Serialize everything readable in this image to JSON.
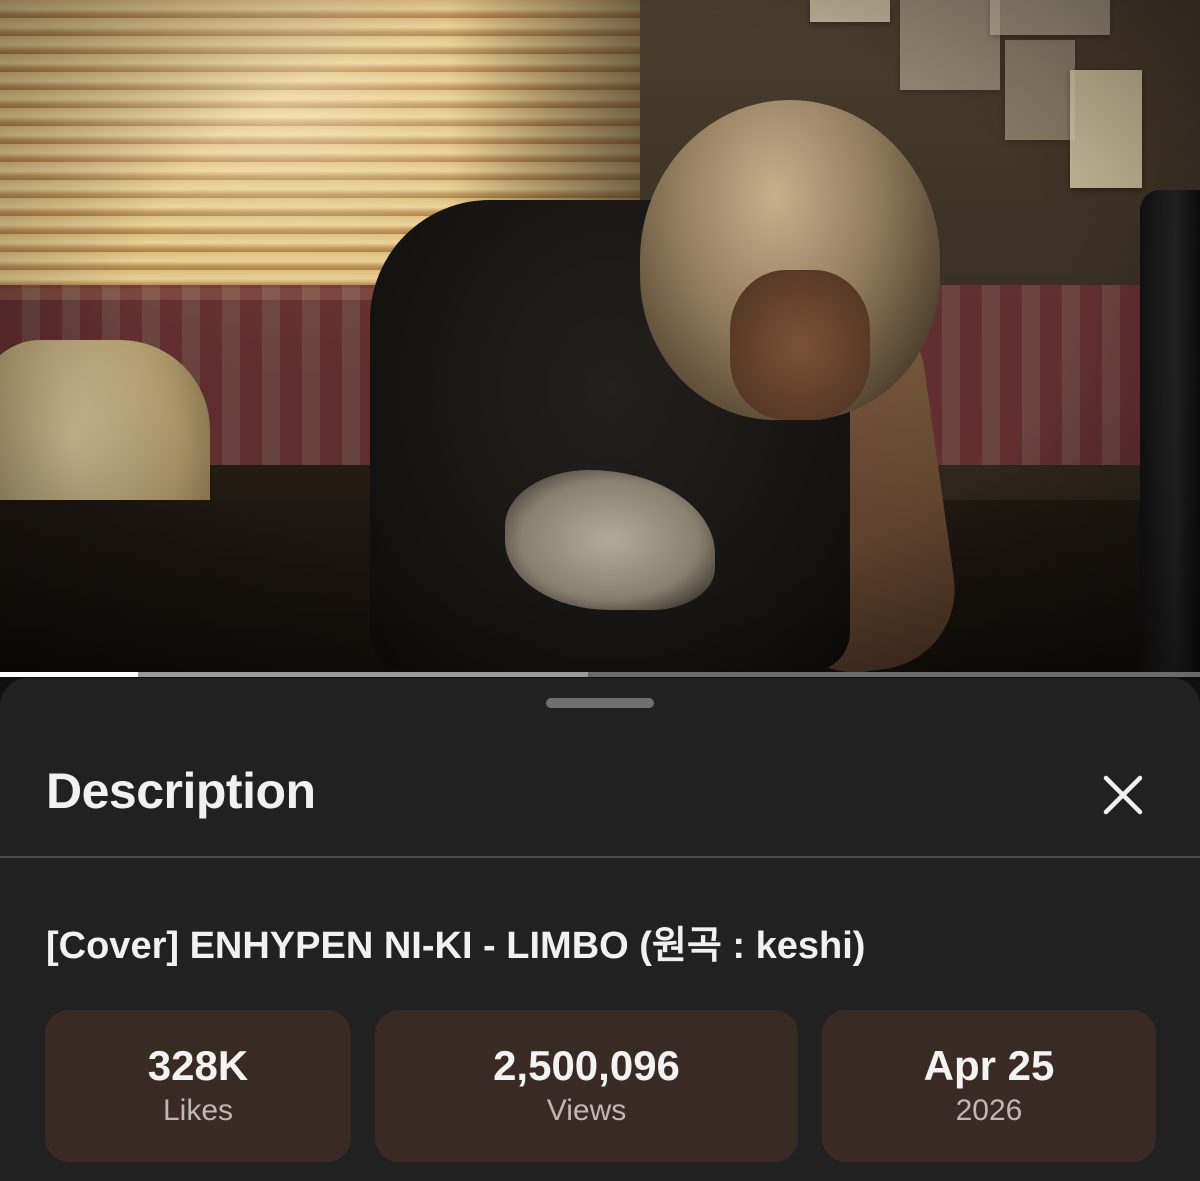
{
  "video": {
    "progress_played": 0.115,
    "progress_buffered": 0.49
  },
  "sheet": {
    "title": "Description",
    "close_icon": "close-icon"
  },
  "details": {
    "video_title": "[Cover] ENHYPEN NI-KI - LIMBO (원곡 : keshi)"
  },
  "stats": [
    {
      "value": "328K",
      "label": "Likes"
    },
    {
      "value": "2,500,096",
      "label": "Views"
    },
    {
      "value": "Apr 25",
      "label": "2026"
    }
  ],
  "colors": {
    "sheet_bg": "#212121",
    "stat_bg": "#3a2a25",
    "text_primary": "#f1f1f1",
    "text_secondary": "#bdb8b5"
  }
}
